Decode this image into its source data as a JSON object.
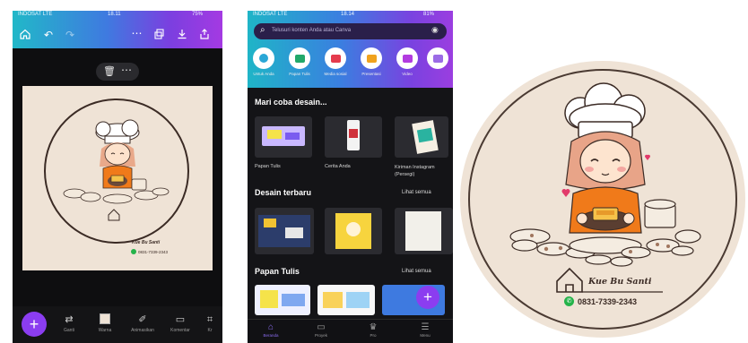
{
  "editor_screen": {
    "status": {
      "carrier": "INDOSAT LTE",
      "time": "18.11",
      "battery": "75%"
    },
    "toolbar_icons": [
      "home-icon",
      "undo-icon",
      "redo-icon",
      "more-icon",
      "layers-icon",
      "download-icon",
      "share-icon"
    ],
    "selection_menu": [
      "trash-icon",
      "more-icon"
    ],
    "canvas": {
      "background": "#efe3d6",
      "logo_name": "Kue Bu Santi",
      "logo_phone": "0831-7339-2343"
    },
    "bottom_tools": [
      {
        "icon": "replace-icon",
        "label": "Ganti"
      },
      {
        "icon": "color-icon",
        "label": "Warna"
      },
      {
        "icon": "eraser-icon",
        "label": "Animasikan"
      },
      {
        "icon": "comment-icon",
        "label": "Komentar"
      },
      {
        "icon": "crop-icon",
        "label": "Kr"
      }
    ]
  },
  "home_screen": {
    "status": {
      "carrier": "INDOSAT LTE",
      "time": "18.14",
      "battery": "81%"
    },
    "search_placeholder": "Telusuri konten Anda atau Canva",
    "categories": [
      {
        "label": "Untuk Anda",
        "color": "#2aa7d6"
      },
      {
        "label": "Papan Tulis",
        "color": "#21a86a"
      },
      {
        "label": "Media sosial",
        "color": "#e53b4d"
      },
      {
        "label": "Presentasi",
        "color": "#f0a21e"
      },
      {
        "label": "Video",
        "color": "#b23be0"
      },
      {
        "label": "",
        "color": "#9b6be6"
      }
    ],
    "try_section": {
      "title": "Mari coba desain...",
      "items": [
        {
          "label": "Papan Tulis"
        },
        {
          "label": "Cerita Anda"
        },
        {
          "label": "Kiriman Instagram (Persegi)"
        }
      ]
    },
    "recent_section": {
      "title": "Desain terbaru",
      "see_all": "Lihat semua"
    },
    "whiteboard_section": {
      "title": "Papan Tulis",
      "see_all": "Lihat semua"
    },
    "bottom_nav": [
      {
        "icon": "home-icon",
        "label": "Beranda"
      },
      {
        "icon": "folder-icon",
        "label": "Proyek"
      },
      {
        "icon": "crown-icon",
        "label": "Pro"
      },
      {
        "icon": "menu-icon",
        "label": "Menu"
      }
    ]
  },
  "logo": {
    "name": "Kue Bu Santi",
    "phone": "0831-7339-2343",
    "background": "#efe3d6",
    "accent": "#f07a1a"
  }
}
